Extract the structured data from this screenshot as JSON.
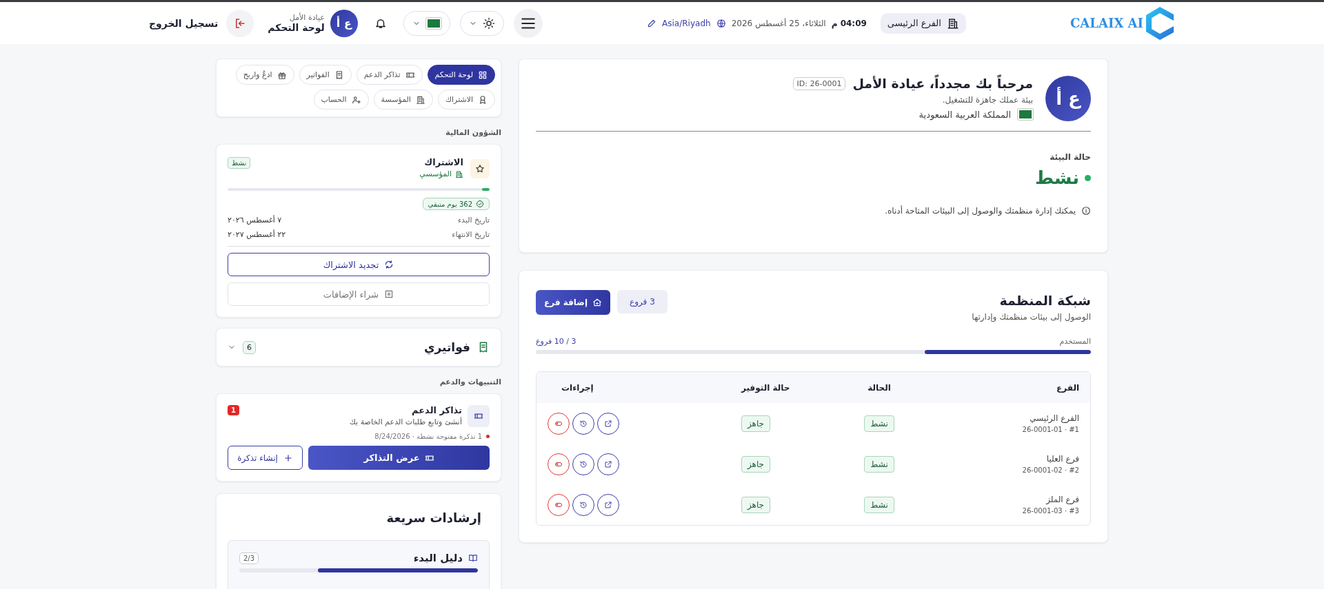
{
  "header": {
    "brand": "CALAIX AI",
    "branch": "الفرع الرئيسى",
    "time": "04:09 م",
    "date": "الثلاثاء، 25 أغسطس 2026",
    "timezone": "Asia/Riyadh",
    "user": {
      "initials": "ع أ",
      "org": "عيادة الأمل",
      "role": "لوحة التحكم"
    },
    "logout": "تسجيل الخروج"
  },
  "welcome": {
    "initials": "ع أ",
    "title": "مرحباً بك مجدداً، عيادة الأمل",
    "id": "ID: 26-0001",
    "subtitle": "بيئة عملك جاهزة للتشغيل.",
    "country": "المملكة العربية السعودية",
    "status_label": "حالة البيئة",
    "status": "نشط",
    "note": "يمكنك إدارة منظمتك والوصول إلى البيئات المتاحة أدناه."
  },
  "network": {
    "title": "شبكة المنظمة",
    "subtitle": "الوصول إلى بيئات منظمتك وإدارتها",
    "count": "3 فروع",
    "add_button": "إضافة فرع",
    "usage_label": "المستخدم",
    "usage": "3 / 10 فروع",
    "level": 0.3,
    "columns": [
      "الفرع",
      "الحالة",
      "حالة التوفير",
      "إجراءات"
    ],
    "rows": [
      {
        "name": "الفرع الرئيسي",
        "code": "26-0001-01 · #1",
        "status": "نشط",
        "provisioning": "جاهز"
      },
      {
        "name": "فرع العليا",
        "code": "26-0001-02 · #2",
        "status": "نشط",
        "provisioning": "جاهز"
      },
      {
        "name": "فرع الملز",
        "code": "26-0001-03 · #3",
        "status": "نشط",
        "provisioning": "جاهز"
      }
    ]
  },
  "nav": [
    {
      "label": "لوحة التحكم",
      "selected": true
    },
    {
      "label": "تذاكر الدعم",
      "selected": false
    },
    {
      "label": "الفواتير",
      "selected": false
    },
    {
      "label": "ادعُ واربح",
      "selected": false
    },
    {
      "label": "الاشتراك",
      "selected": false
    },
    {
      "label": "المؤسسة",
      "selected": false
    },
    {
      "label": "الحساب",
      "selected": false
    }
  ],
  "finance": {
    "section": "الشؤون المالية",
    "subscription": {
      "title": "الاشتراك",
      "plan": "المؤسسي",
      "status": "نشط",
      "level": 0.03,
      "remaining": "362 يوم متبقي",
      "fields": [
        {
          "label": "تاريخ البدء",
          "value": "٧ أغسطس ٢٠٢٦"
        },
        {
          "label": "تاريخ الانتهاء",
          "value": "٢٢ أغسطس ٢٠٢٧"
        }
      ],
      "renew": "تجديد الاشتراك",
      "addons": "شراء الإضافات"
    },
    "invoices": {
      "title": "فواتيري",
      "count": "6",
      "expanded": false
    }
  },
  "support": {
    "section": "التنبيهات والدعم",
    "title": "تذاكر الدعم",
    "subtitle": "أنشئ وتابع طلبات الدعم الخاصة بك",
    "badge": "1",
    "summary": "1 تذكرة مفتوحة نشطة · 8/24/2026",
    "view": "عرض التذاكر",
    "create": "إنشاء تذكرة"
  },
  "guide": {
    "title": "إرشادات سريعة",
    "item": "دليل البدء",
    "progress": "2/3",
    "level": 0.67
  }
}
